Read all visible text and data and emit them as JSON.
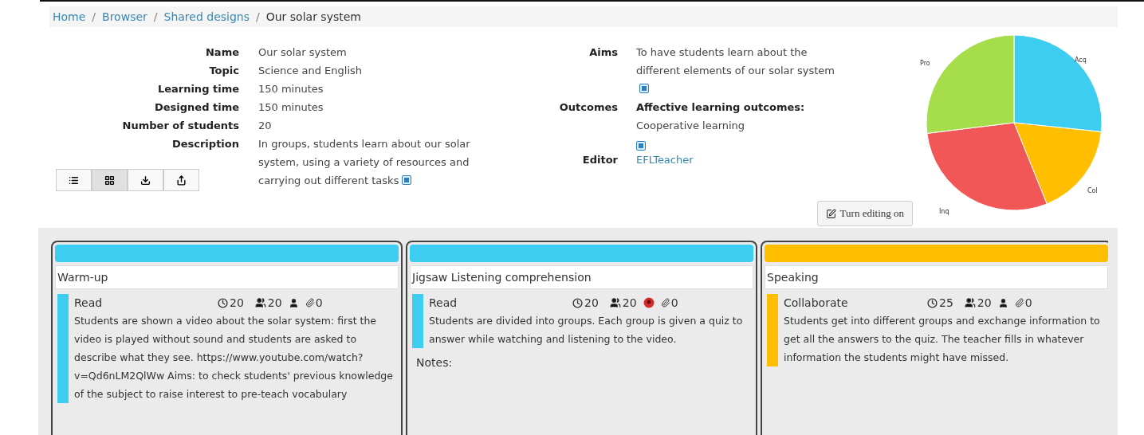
{
  "breadcrumb": [
    {
      "label": "Home",
      "link": true
    },
    {
      "separator": "/",
      "label": "Browser",
      "link": true
    },
    {
      "separator": "/",
      "label": "Shared designs",
      "link": true
    },
    {
      "separator": "/",
      "label": "Our solar system",
      "link": false
    }
  ],
  "details": [
    {
      "label": "Name",
      "value": "Our solar system"
    },
    {
      "label": "Topic",
      "value": "Science and English"
    },
    {
      "label": "Learning time",
      "value": "150 minutes"
    },
    {
      "label": "Designed time",
      "value": "150 minutes"
    },
    {
      "label": "Number of students",
      "value": "20"
    },
    {
      "label": "Description",
      "value": "In groups, students learn about our solar system, using a variety of resources and carrying out different tasks",
      "expandable": true
    }
  ],
  "view_buttons": [
    {
      "kind": "list",
      "selected": false
    },
    {
      "kind": "grid",
      "selected": true
    },
    {
      "kind": "download",
      "selected": false
    },
    {
      "kind": "share",
      "selected": false
    }
  ],
  "aims": {
    "label": "Aims",
    "value": "To have students learn about the different elements of our solar system"
  },
  "outcomes": {
    "label": "Outcomes",
    "heading": "Affective learning outcomes:",
    "value": "Cooperative learning"
  },
  "editor": {
    "label": "Editor",
    "value": "EFLTeacher"
  },
  "edit_button": "Turn editing on",
  "pie": {
    "slices": [
      {
        "label": "Acq",
        "color": "#3dcdf0"
      },
      {
        "label": "Col",
        "color": "#ffbf00"
      },
      {
        "label": "Inq",
        "color": "#f25757"
      },
      {
        "label": "Pro",
        "color": "#a6dd4a"
      }
    ]
  },
  "cards": [
    {
      "title": "Warm-up",
      "color": "#3dcdf0",
      "activity": {
        "type": "Read",
        "time": "20",
        "group": "20",
        "role": {
          "kind": "person"
        },
        "resources": "0",
        "description": "Students are shown a video about the solar system: first the video is played without sound and students are asked to describe what they see. https://www.youtube.com/watch?v=Qd6nLM2QlWw Aims: to check students' previous knowledge of the subject to raise interest to pre-teach vocabulary"
      }
    },
    {
      "title": "Jigsaw Listening comprehension",
      "color": "#3dcdf0",
      "activity": {
        "type": "Read",
        "time": "20",
        "group": "20",
        "role": {
          "kind": "badge"
        },
        "resources": "0",
        "description": "Students are divided into groups. Each group is given a quiz to answer while watching and listening to the video."
      },
      "notes": "Notes:"
    },
    {
      "title": "Speaking",
      "color": "#ffbf00",
      "activity": {
        "type": "Collaborate",
        "time": "25",
        "group": "20",
        "role": {
          "kind": "person"
        },
        "resources": "0",
        "description": "Students get into different groups and exchange information to get all the answers to the quiz. The teacher fills in whatever information the students might have missed."
      }
    }
  ]
}
